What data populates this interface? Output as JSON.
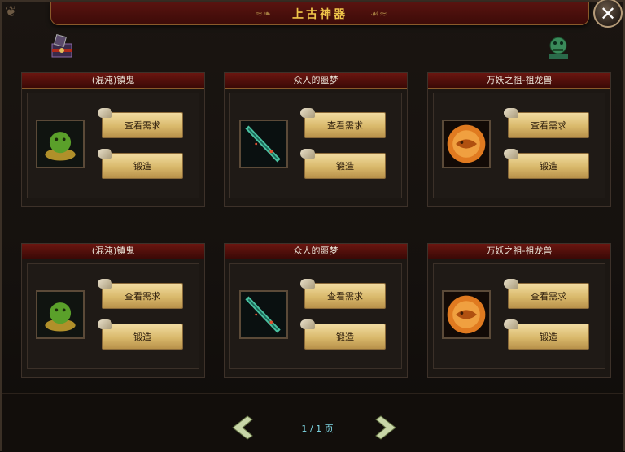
{
  "title": "上古神器",
  "panels": [
    {
      "name": "(混沌)镇鬼",
      "item": "green-lion-statue-icon",
      "view_label": "查看需求",
      "forge_label": "锻造"
    },
    {
      "name": "众人的噩梦",
      "item": "jade-sword-icon",
      "view_label": "查看需求",
      "forge_label": "锻造"
    },
    {
      "name": "万妖之祖-祖龙兽",
      "item": "orange-dragon-orb-icon",
      "view_label": "查看需求",
      "forge_label": "锻造"
    },
    {
      "name": "(混沌)镇鬼",
      "item": "green-lion-statue-icon",
      "view_label": "查看需求",
      "forge_label": "锻造"
    },
    {
      "name": "众人的噩梦",
      "item": "jade-sword-icon",
      "view_label": "查看需求",
      "forge_label": "锻造"
    },
    {
      "name": "万妖之祖-祖龙兽",
      "item": "orange-dragon-orb-icon",
      "view_label": "查看需求",
      "forge_label": "锻造"
    }
  ],
  "pager": {
    "current": "1",
    "separator": "/",
    "total": "1",
    "unit": "页"
  },
  "colors": {
    "title": "#f0c64a",
    "header_red": "#6a1610",
    "button_gold": "#d9b96b",
    "pager_cyan": "#7fd8e6"
  }
}
